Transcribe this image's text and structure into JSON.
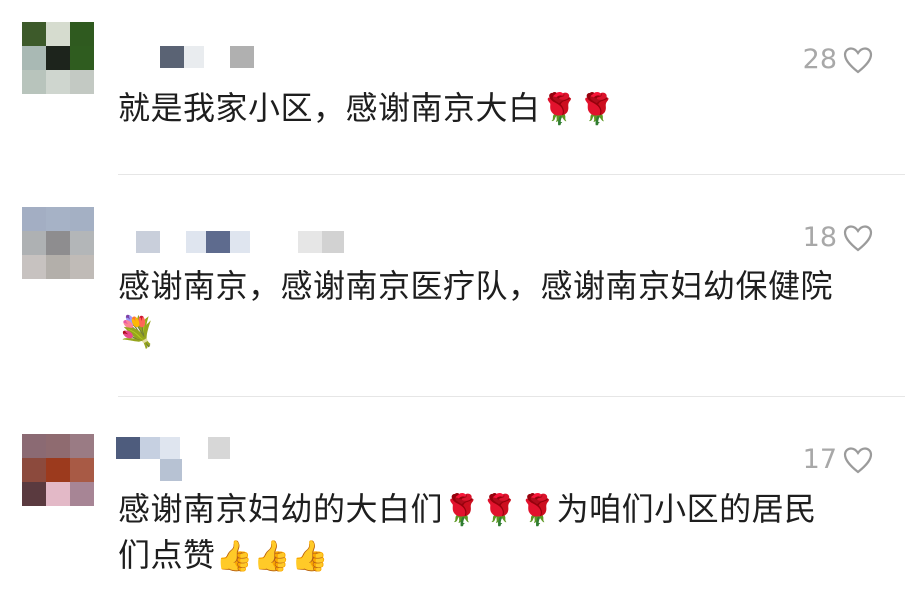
{
  "comments": [
    {
      "likes": "28",
      "text": "就是我家小区，感谢南京大白",
      "emoji": "🌹🌹",
      "avatar_colors": [
        "#3d5a2a",
        "#d6dccf",
        "#2f5a1f",
        "#a9b9b4",
        "#1d241c",
        "#2f5c1f",
        "#b8c4bc",
        "#cfd6cf",
        "#c3c9c3"
      ]
    },
    {
      "likes": "18",
      "text": "感谢南京，感谢南京医疗队，感谢南京妇幼保健院",
      "emoji": "💐",
      "avatar_colors": [
        "#a3aec3",
        "#a6b2c6",
        "#a4b0c4",
        "#aeb1b3",
        "#8e8d8f",
        "#b3b6b8",
        "#c7c2c0",
        "#b3afaa",
        "#c0bbb7"
      ]
    },
    {
      "likes": "17",
      "text": "感谢南京妇幼的大白们",
      "text2": "为咱们小区的居民",
      "text3": "们点赞",
      "emoji_mid": "🌹🌹🌹",
      "emoji_end": "👍👍👍",
      "avatar_colors": [
        "#8b6a73",
        "#8f6b70",
        "#9a7b84",
        "#8c4a3d",
        "#9c3a1d",
        "#a85a45",
        "#5a3a3f",
        "#e3b9c7",
        "#a78595"
      ]
    }
  ]
}
